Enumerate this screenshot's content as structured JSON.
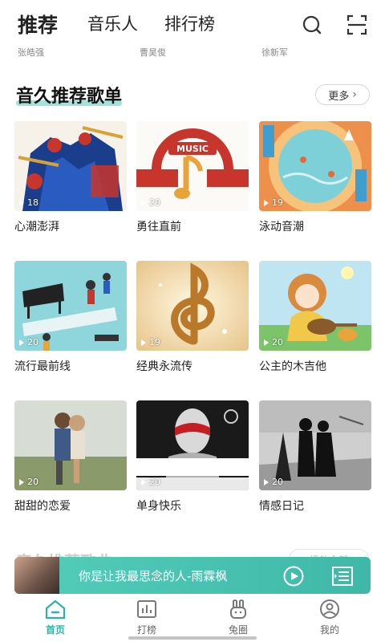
{
  "top_tabs": [
    {
      "label": "推荐",
      "active": true
    },
    {
      "label": "音乐人",
      "active": false
    },
    {
      "label": "排行榜",
      "active": false
    }
  ],
  "top_icons": [
    "search-icon",
    "scan-icon"
  ],
  "singers": [
    "张皓强",
    "曹昊俊",
    "徐新军"
  ],
  "section": {
    "title": "音久推荐歌单",
    "more_label": "更多"
  },
  "playlists": [
    {
      "title": "心潮澎湃",
      "plays": "18",
      "cover": "brass-band"
    },
    {
      "title": "勇往直前",
      "plays": "20",
      "cover": "music-imagine"
    },
    {
      "title": "泳动音潮",
      "plays": "19",
      "cover": "swimming-pool"
    },
    {
      "title": "流行最前线",
      "plays": "20",
      "cover": "musicians"
    },
    {
      "title": "经典永流传",
      "plays": "19",
      "cover": "golden-clef"
    },
    {
      "title": "公主的木吉他",
      "plays": "20",
      "cover": "girl-guitar"
    },
    {
      "title": "甜甜的恋爱",
      "plays": "20",
      "cover": "couple"
    },
    {
      "title": "单身快乐",
      "plays": "20",
      "cover": "no-love"
    },
    {
      "title": "情感日记",
      "plays": "20",
      "cover": "silhouette"
    }
  ],
  "section2": {
    "title": "音久推荐歌曲",
    "more_label": "播放全部"
  },
  "player": {
    "title": "你是让我最思念的人-雨霖枫"
  },
  "bottom_nav": [
    {
      "label": "首页",
      "icon": "home-icon",
      "active": true
    },
    {
      "label": "打榜",
      "icon": "chart-icon",
      "active": false
    },
    {
      "label": "兔圈",
      "icon": "rabbit-icon",
      "active": false
    },
    {
      "label": "我的",
      "icon": "profile-icon",
      "active": false
    }
  ],
  "colors": {
    "accent": "#40c8b4",
    "active_nav": "#27b6a2"
  }
}
